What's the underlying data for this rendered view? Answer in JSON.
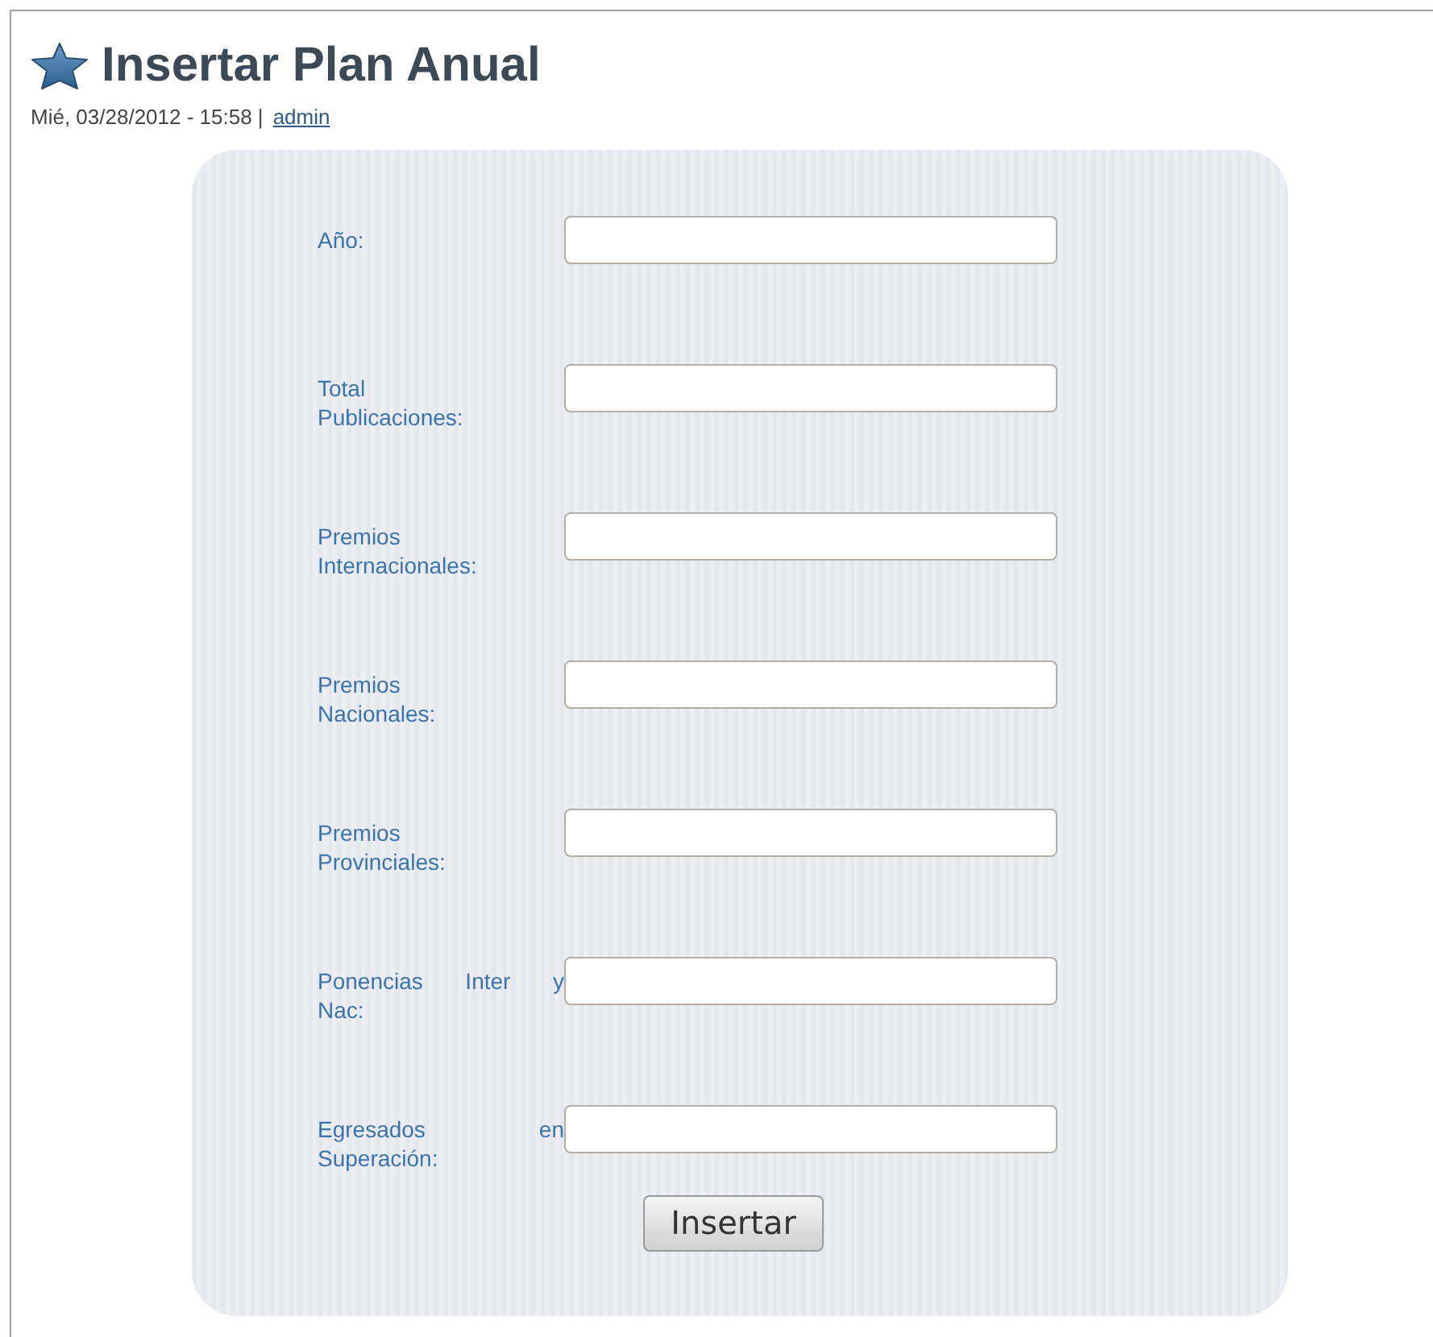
{
  "page": {
    "title": "Insertar Plan Anual",
    "meta": "Mié, 03/28/2012 - 15:58 |",
    "author": "admin"
  },
  "form": {
    "fields": [
      {
        "label_lines": [
          "Año:"
        ]
      },
      {
        "label_lines": [
          "Total",
          "Publicaciones:"
        ]
      },
      {
        "label_lines": [
          "Premios",
          "Internacionales:"
        ]
      },
      {
        "label_lines": [
          "Premios",
          "Nacionales:"
        ]
      },
      {
        "label_lines": [
          "Premios",
          "Provinciales:"
        ]
      },
      {
        "label_lines": [
          "Ponencias Inter y",
          "Nac:"
        ]
      },
      {
        "label_lines": [
          "Egresados en",
          "Superación:"
        ]
      }
    ],
    "submit": "Insertar"
  }
}
